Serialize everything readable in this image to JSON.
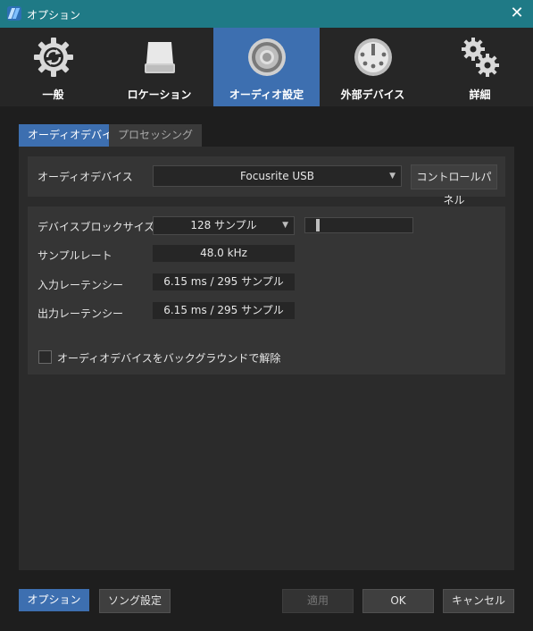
{
  "window": {
    "title": "オプション",
    "close_glyph": "✕"
  },
  "categories": [
    {
      "label": "一般",
      "icon": "gear-refresh-icon",
      "active": false
    },
    {
      "label": "ロケーション",
      "icon": "drive-icon",
      "active": false
    },
    {
      "label": "オーディオ設定",
      "icon": "speaker-icon",
      "active": true
    },
    {
      "label": "外部デバイス",
      "icon": "midi-port-icon",
      "active": false
    },
    {
      "label": "詳細",
      "icon": "gears-icon",
      "active": false
    }
  ],
  "tabs": [
    {
      "label": "オーディオデバイス",
      "active": true
    },
    {
      "label": "プロセッシング",
      "active": false
    }
  ],
  "audio_device": {
    "label": "オーディオデバイス",
    "value": "Focusrite USB",
    "control_panel_button": "コントロールパネル"
  },
  "settings": {
    "block_size_label": "デバイスブロックサイズ",
    "block_size_value": "128 サンプル",
    "block_size_slider_fraction": 0.1,
    "sample_rate_label": "サンプルレート",
    "sample_rate_value": "48.0 kHz",
    "input_latency_label": "入力レーテンシー",
    "input_latency_value": "6.15 ms / 295 サンプル",
    "output_latency_label": "出力レーテンシー",
    "output_latency_value": "6.15 ms / 295 サンプル",
    "background_release_label": "オーディオデバイスをバックグラウンドで解除",
    "background_release_checked": false
  },
  "footer": {
    "options_button": "オプション",
    "song_settings_button": "ソング設定",
    "apply_button": "適用",
    "ok_button": "OK",
    "cancel_button": "キャンセル"
  },
  "colors": {
    "titlebar": "#1f7a86",
    "accent": "#3d6fb0",
    "background": "#1e1e1e"
  }
}
